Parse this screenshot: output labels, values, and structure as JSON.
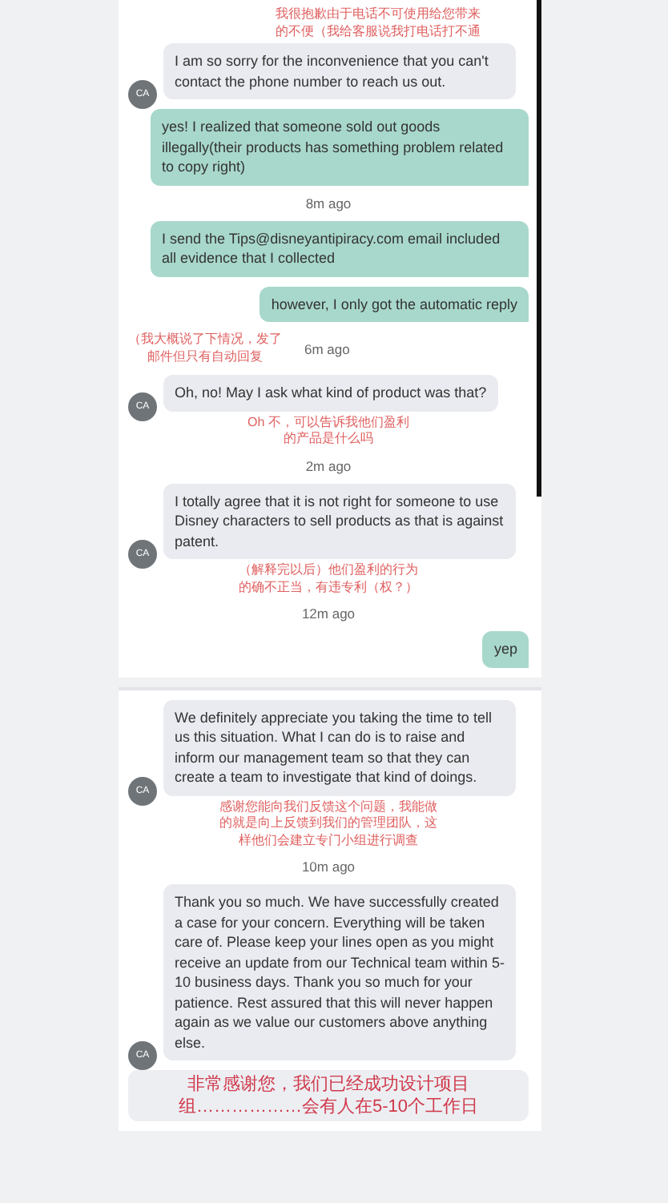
{
  "sections": [
    {
      "items": [
        {
          "kind": "topnote",
          "lines": [
            "我很抱歉由于电话不可使用给您带来",
            "的不便（我给客服说我打电话打不通"
          ]
        },
        {
          "kind": "agent",
          "avatar": "CA",
          "text": "I am so sorry for the inconvenience that you can't contact the phone number to reach us out."
        },
        {
          "kind": "user",
          "text": "yes! I realized that someone sold out goods illegally(their products has something problem related to copy right)"
        },
        {
          "kind": "time",
          "text": "8m ago"
        },
        {
          "kind": "user",
          "text": "I send the Tips@disneyantipiracy.com email included all evidence that I collected"
        },
        {
          "kind": "user",
          "text": "however, I only got the automatic reply"
        },
        {
          "kind": "time",
          "text": "6m ago",
          "note": [
            "（我大概说了下情况，发了",
            "邮件但只有自动回复"
          ]
        },
        {
          "kind": "agent",
          "avatar": "CA",
          "text": "Oh, no! May I ask what kind of product was that?"
        },
        {
          "kind": "note",
          "lines": [
            "Oh 不，可以告诉我他们盈利",
            "的产品是什么吗"
          ]
        },
        {
          "kind": "time",
          "text": "2m ago"
        },
        {
          "kind": "agent",
          "avatar": "CA",
          "text": "I totally agree that it is not right for someone to use Disney characters to sell products as that is against patent."
        },
        {
          "kind": "note",
          "lines": [
            "（解释完以后）他们盈利的行为",
            "的确不正当，有违专利（权？）"
          ]
        },
        {
          "kind": "time",
          "text": "12m ago"
        },
        {
          "kind": "user",
          "text": "yep"
        }
      ]
    },
    {
      "items": [
        {
          "kind": "agent",
          "avatar": "CA",
          "text": "We definitely appreciate you taking the time to tell us this situation. What I can do is to raise and inform our management team so that they can create a team to investigate that kind of doings."
        },
        {
          "kind": "note",
          "lines": [
            "感谢您能向我们反馈这个问题，我能做",
            "的就是向上反馈到我们的管理团队，这",
            "样他们会建立专门小组进行调查"
          ]
        },
        {
          "kind": "time",
          "text": "10m ago"
        },
        {
          "kind": "agent",
          "avatar": "CA",
          "text": "Thank you so much. We have successfully created a case for your concern. Everything will be taken care of. Please keep your lines open as you might receive an update from our Technical team within 5-10 business days. Thank you so much for your patience. Rest assured that this will never happen again as we value our customers above anything else."
        },
        {
          "kind": "banner",
          "lines": [
            "非常感谢您，我们已经成功设计项目",
            "组………………会有人在5-10个工作日"
          ]
        }
      ]
    }
  ]
}
